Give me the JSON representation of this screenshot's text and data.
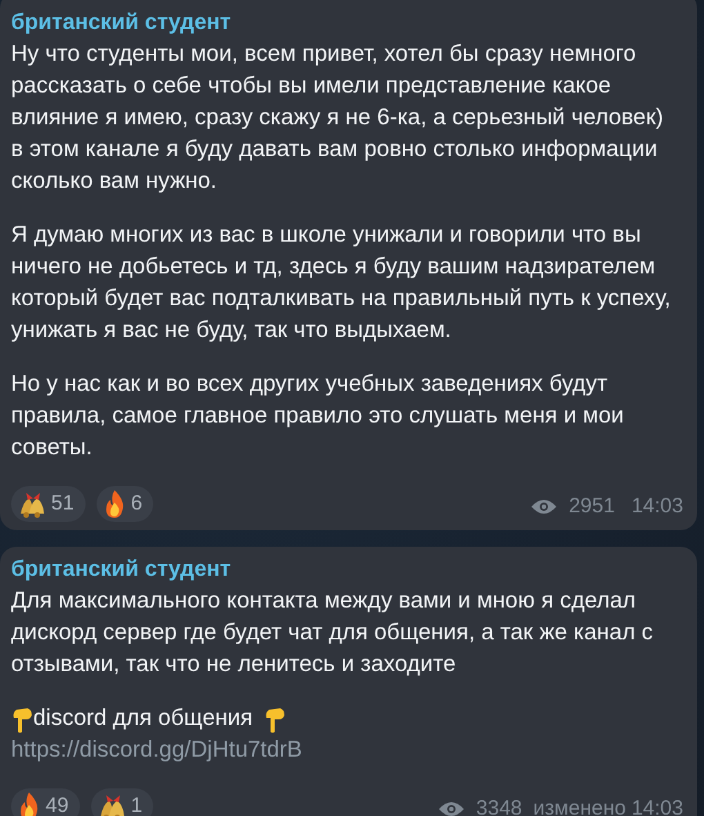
{
  "messages": [
    {
      "channel": "британский студент",
      "paragraphs": [
        [
          {
            "kind": "text",
            "text": "Ну что студенты мои, всем привет, хотел бы сразу немного рассказать о себе чтобы вы имели представление какое влияние я имею, сразу скажу я не 6-ка, а серьезный человек) в этом канале я буду давать вам ровно столько информации сколько вам нужно."
          }
        ],
        [
          {
            "kind": "text",
            "text": "Я думаю многих из вас в школе унижали и говорили что вы ничего не добьетесь и тд, здесь я буду вашим надзирателем который будет вас подталкивать на правильный путь к успеху, унижать я вас не буду, так что выдыхаем."
          }
        ],
        [
          {
            "kind": "text",
            "text": "Но у нас как и во всех других учебных заведениях будут правила, самое главное правило это слушать меня и  мои советы."
          }
        ]
      ],
      "reactions": [
        {
          "kind": "bell",
          "count": "51"
        },
        {
          "kind": "fire",
          "count": "6"
        }
      ],
      "views": "2951",
      "time": "14:03"
    },
    {
      "channel": "британский студент",
      "paragraphs": [
        [
          {
            "kind": "text",
            "text": "Для максимального контакта между вами и мною я сделал дискорд сервер где будет чат для общения, а так же канал с отзывами, так что не ленитесь и заходите"
          }
        ],
        [
          {
            "kind": "pointer",
            "text": "discord для общения"
          },
          {
            "kind": "link",
            "text": "https://discord.gg/DjHtu7tdrB"
          }
        ]
      ],
      "reactions": [
        {
          "kind": "fire",
          "count": "49"
        },
        {
          "kind": "bell",
          "count": "1"
        }
      ],
      "views": "3348",
      "edited": "изменено",
      "time": "14:03"
    }
  ]
}
